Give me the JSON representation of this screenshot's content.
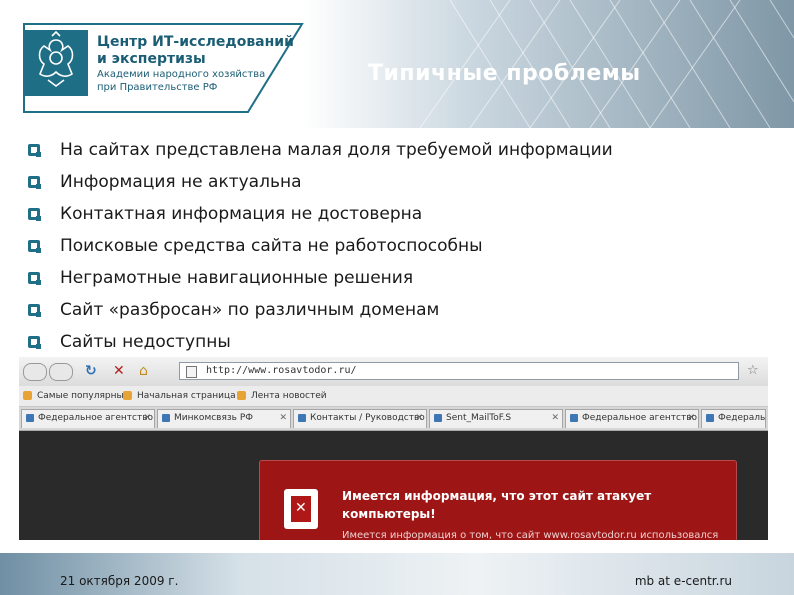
{
  "header": {
    "logo": {
      "line1": "Центр ИТ-исследований",
      "line2": "и экспертизы",
      "line3": "Академии народного хозяйства",
      "line4": "при Правительстве РФ"
    },
    "title": "Типичные проблемы"
  },
  "bullets": [
    "На сайтах представлена малая доля требуемой информации",
    "Информация не актуальна",
    "Контактная информация не достоверна",
    "Поисковые средства сайта не работоспособны",
    "Неграмотные навигационные решения",
    "Сайт «разбросан» по различным доменам",
    "Сайты недоступны"
  ],
  "browser": {
    "url": "http://www.rosavtodor.ru/",
    "bookmarks": [
      "Самые популярные",
      "Начальная страница",
      "Лента новостей"
    ],
    "tabs": [
      "Федеральное агентство ...",
      "Минкомсвязь РФ",
      "Контакты / Руководство ...",
      "Sent_MailToF.S",
      "Федеральное агентство ...",
      "Федеральное агентство ..."
    ],
    "warning": {
      "title": "Имеется информация, что этот сайт атакует компьютеры!",
      "subtitle": "Имеется информация о том, что сайт www.rosavtodor.ru использовался"
    }
  },
  "footer": {
    "date": "21 октября 2009 г.",
    "author": "mb at e-centr.ru"
  },
  "colors": {
    "accent": "#1f6f86",
    "warning": "#9d1515"
  }
}
